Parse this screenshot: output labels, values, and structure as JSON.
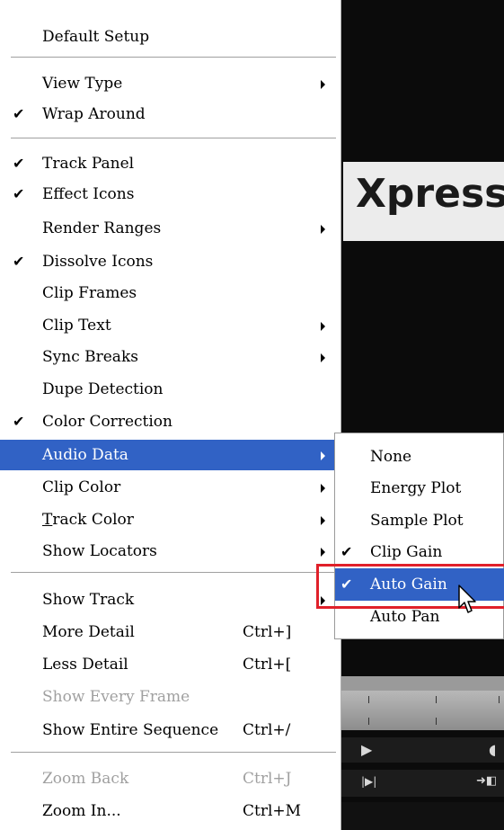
{
  "app": {
    "banner_text": "Xpress"
  },
  "menu": {
    "items": [
      {
        "label": "Default Setup",
        "checked": false,
        "submenu": false,
        "enabled": true
      },
      {
        "label": "View Type",
        "checked": false,
        "submenu": true,
        "enabled": true
      },
      {
        "label": "Wrap Around",
        "checked": true,
        "submenu": false,
        "enabled": true
      },
      {
        "label": "Track Panel",
        "checked": true,
        "submenu": false,
        "enabled": true
      },
      {
        "label": "Effect Icons",
        "checked": true,
        "submenu": false,
        "enabled": true
      },
      {
        "label": "Render Ranges",
        "checked": false,
        "submenu": true,
        "enabled": true
      },
      {
        "label": "Dissolve Icons",
        "checked": true,
        "submenu": false,
        "enabled": true
      },
      {
        "label": "Clip Frames",
        "checked": false,
        "submenu": false,
        "enabled": true
      },
      {
        "label": "Clip Text",
        "checked": false,
        "submenu": true,
        "enabled": true
      },
      {
        "label": "Sync Breaks",
        "checked": false,
        "submenu": true,
        "enabled": true
      },
      {
        "label": "Dupe Detection",
        "checked": false,
        "submenu": false,
        "enabled": true
      },
      {
        "label": "Color Correction",
        "checked": true,
        "submenu": false,
        "enabled": true
      },
      {
        "label": "Audio Data",
        "checked": false,
        "submenu": true,
        "enabled": true,
        "highlighted": true
      },
      {
        "label": "Clip Color",
        "checked": false,
        "submenu": true,
        "enabled": true
      },
      {
        "label_first": "T",
        "label_rest": "rack Color",
        "checked": false,
        "submenu": true,
        "enabled": true
      },
      {
        "label": "Show Locators",
        "checked": false,
        "submenu": true,
        "enabled": true
      },
      {
        "label": "Show Track",
        "checked": false,
        "submenu": true,
        "enabled": true
      },
      {
        "label": "More Detail",
        "shortcut": "Ctrl+]",
        "checked": false,
        "submenu": false,
        "enabled": true
      },
      {
        "label": "Less Detail",
        "shortcut": "Ctrl+[",
        "checked": false,
        "submenu": false,
        "enabled": true
      },
      {
        "label": "Show Every Frame",
        "checked": false,
        "submenu": false,
        "enabled": false
      },
      {
        "label": "Show Entire Sequence",
        "shortcut": "Ctrl+/",
        "checked": false,
        "submenu": false,
        "enabled": true
      },
      {
        "label": "Zoom Back",
        "shortcut": "Ctrl+J",
        "checked": false,
        "submenu": false,
        "enabled": false
      },
      {
        "label": "Zoom In...",
        "shortcut": "Ctrl+M",
        "checked": false,
        "submenu": false,
        "enabled": true
      }
    ],
    "check_glyph": "✔"
  },
  "submenu": {
    "items": [
      {
        "label": "None",
        "checked": false
      },
      {
        "label": "Energy Plot",
        "checked": false
      },
      {
        "label": "Sample Plot",
        "checked": false
      },
      {
        "label": "Clip Gain",
        "checked": true
      },
      {
        "label": "Auto Gain",
        "checked": true,
        "highlighted": true
      },
      {
        "label": "Auto Pan",
        "checked": false
      }
    ]
  },
  "timeline_controls": {
    "row1_left": "▶",
    "row1_right": "◖",
    "row2_left": "|▶|",
    "row2_right": "➜◧"
  },
  "colors": {
    "highlight": "#3162c5",
    "annotation_box": "#e0202a"
  }
}
